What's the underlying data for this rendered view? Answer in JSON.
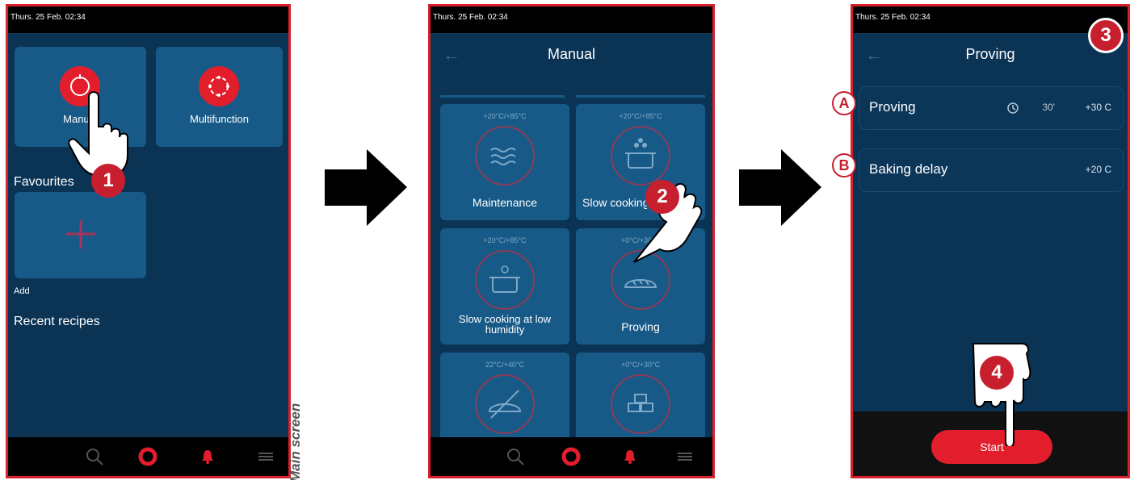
{
  "status_time": "Thurs. 25 Feb. 02:34",
  "screen1": {
    "tiles": [
      {
        "label": "Manual",
        "icon": "manual-icon"
      },
      {
        "label": "Multifunction",
        "icon": "multifunction-icon"
      }
    ],
    "favourites_heading": "Favourites",
    "add_label": "Add",
    "recent_heading": "Recent recipes",
    "caption": "Main screen",
    "bottom_nav": [
      "search-icon",
      "home-ring-icon",
      "notification-bell-icon",
      "menu-icon"
    ]
  },
  "screen2": {
    "title": "Manual",
    "programs": [
      {
        "label": "Maintenance",
        "temp": "+20°C/+85°C",
        "icon": "steam-waves-icon"
      },
      {
        "label": "Slow cooking",
        "temp": "+20°C/+85°C",
        "icon": "steaming-pot-icon"
      },
      {
        "label": "Slow cooking at low humidity",
        "temp": "+20°C/+85°C",
        "icon": "pot-icon"
      },
      {
        "label": "Proving",
        "temp": "+0°C/+30°C",
        "icon": "bread-icon"
      },
      {
        "label": "",
        "temp": "22°C/+40°C",
        "icon": "bread-crossed-icon"
      },
      {
        "label": "",
        "temp": "+0°C/+30°C",
        "icon": "dough-icon"
      }
    ]
  },
  "screen3": {
    "title": "Proving",
    "rows": [
      {
        "letter": "A",
        "name": "Proving",
        "time": "30'",
        "temp": "+30 C"
      },
      {
        "letter": "B",
        "name": "Baking delay",
        "time": "",
        "temp": "+20 C"
      }
    ],
    "start_label": "Start"
  },
  "steps": [
    "1",
    "2",
    "3",
    "4"
  ],
  "colors": {
    "accent_red": "#e31e2c",
    "screen_bg": "#0a3354",
    "tile_bg": "#175a87",
    "frame": "#d81f2a"
  }
}
